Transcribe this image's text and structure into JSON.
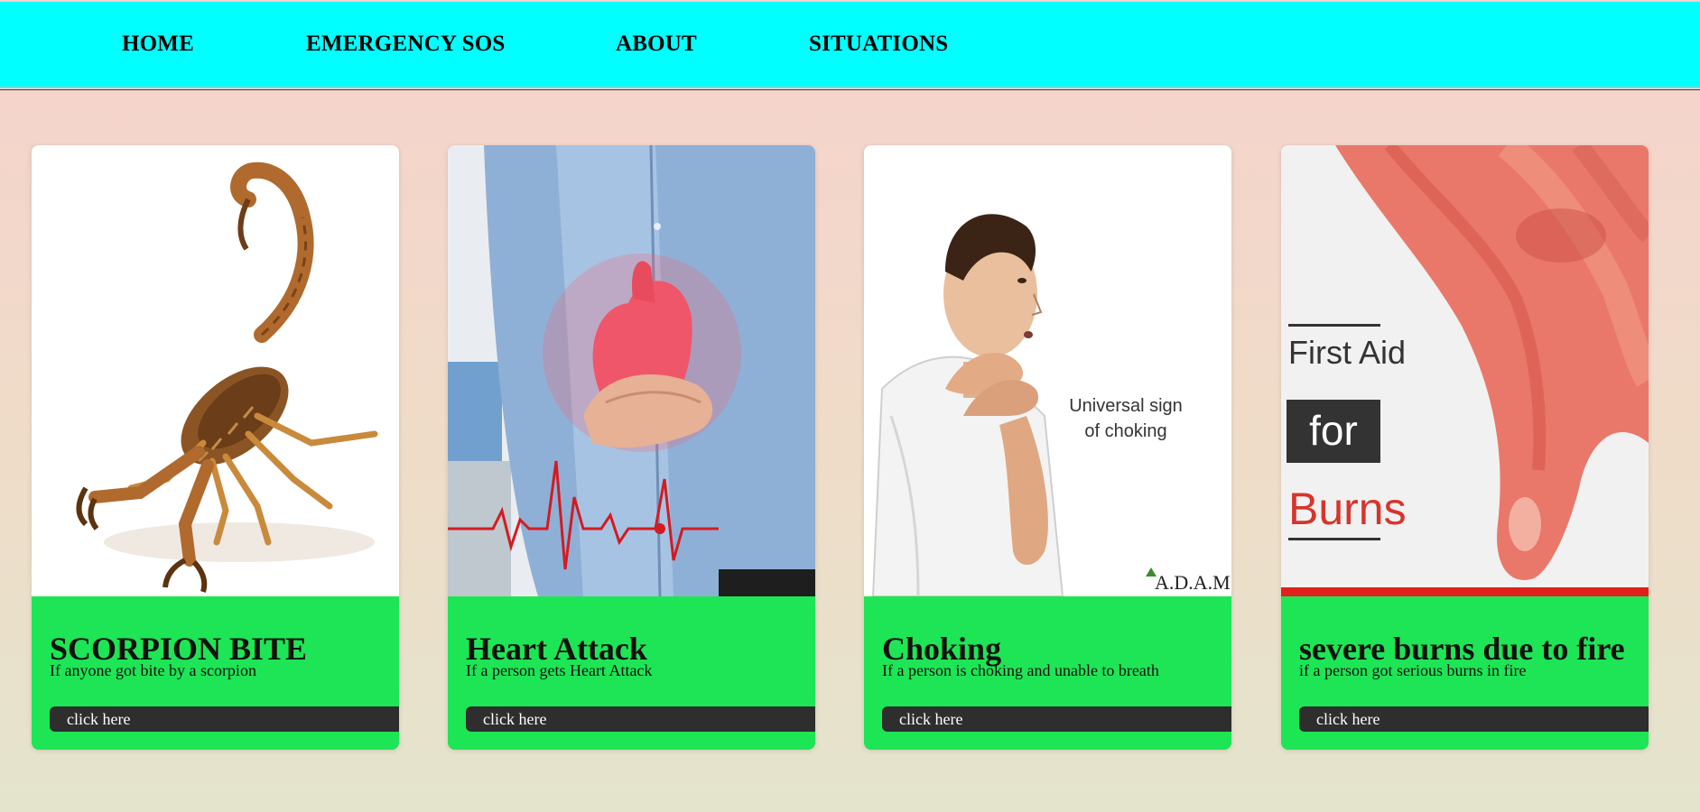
{
  "nav": {
    "items": [
      {
        "label": "HOME"
      },
      {
        "label": "EMERGENCY SOS"
      },
      {
        "label": "ABOUT"
      },
      {
        "label": "SITUATIONS"
      }
    ]
  },
  "cards": [
    {
      "title": "SCORPION BITE",
      "subtitle": "If anyone got bite by a scorpion",
      "button": "click here",
      "image": "scorpion-illustration"
    },
    {
      "title": "Heart Attack",
      "subtitle": "If a person gets Heart Attack",
      "button": "click here",
      "image": "heart-attack-illustration"
    },
    {
      "title": "Choking",
      "subtitle": "If a person is choking and unable to breath",
      "button": "click here",
      "image": "choking-illustration",
      "image_text": {
        "line1": "Universal sign",
        "line2": "of choking",
        "credit": "A.D.A.M."
      }
    },
    {
      "title": "severe burns due to fire",
      "subtitle": "if a person got serious burns in fire",
      "button": "click here",
      "image": "burns-illustration",
      "image_text": {
        "line1": "First Aid",
        "line2": "for",
        "line3": "Burns"
      }
    }
  ],
  "colors": {
    "nav_bg": "#00ffff",
    "card_bg": "#1ee555",
    "button_bg": "#2e2e2e"
  }
}
